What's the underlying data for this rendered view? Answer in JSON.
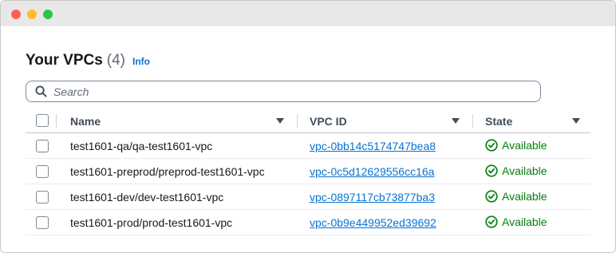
{
  "window": {
    "controls": {
      "close_color": "#ff5f57",
      "minimize_color": "#febc2e",
      "maximize_color": "#28c840"
    }
  },
  "header": {
    "title": "Your VPCs",
    "count": "(4)",
    "info_label": "Info"
  },
  "search": {
    "placeholder": "Search",
    "value": ""
  },
  "table": {
    "columns": [
      {
        "label": "Name"
      },
      {
        "label": "VPC ID"
      },
      {
        "label": "State"
      }
    ],
    "rows": [
      {
        "name": "test1601-qa/qa-test1601-vpc",
        "vpc_id": "vpc-0bb14c5174747bea8",
        "state": "Available"
      },
      {
        "name": "test1601-preprod/preprod-test1601-vpc",
        "vpc_id": "vpc-0c5d12629556cc16a",
        "state": "Available"
      },
      {
        "name": "test1601-dev/dev-test1601-vpc",
        "vpc_id": "vpc-0897117cb73877ba3",
        "state": "Available"
      },
      {
        "name": "test1601-prod/prod-test1601-vpc",
        "vpc_id": "vpc-0b9e449952ed39692",
        "state": "Available"
      }
    ]
  },
  "colors": {
    "link": "#0972d3",
    "success": "#037f0c",
    "text": "#16191f"
  },
  "icons": {
    "search": "search-icon",
    "sort": "caret-down-icon",
    "status": "check-circle-icon"
  }
}
